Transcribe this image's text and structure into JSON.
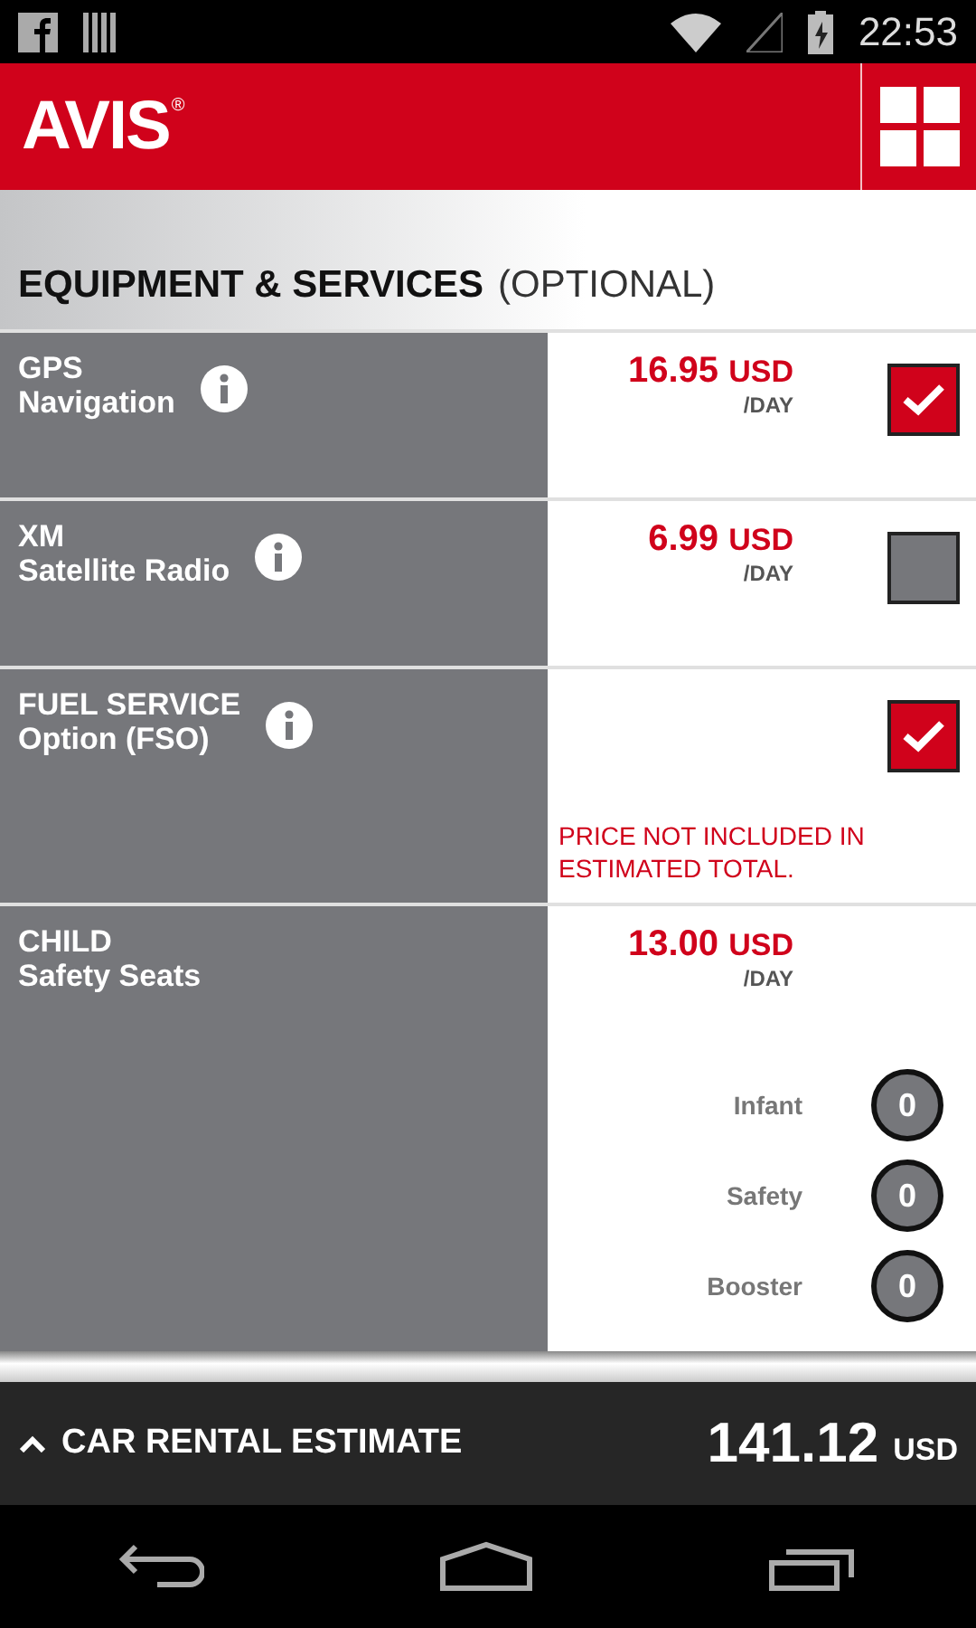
{
  "status_bar": {
    "time": "22:53"
  },
  "header": {
    "logo": "AVIS",
    "logo_mark": "®"
  },
  "section": {
    "title": "EQUIPMENT & SERVICES",
    "subtitle": "(OPTIONAL)"
  },
  "items": [
    {
      "kind": "checkbox",
      "name_line1": "GPS",
      "name_line2": "Navigation",
      "info": true,
      "price": "16.95",
      "currency": "USD",
      "per": "/DAY",
      "checked": true
    },
    {
      "kind": "checkbox",
      "name_line1": "XM",
      "name_line2": "Satellite Radio",
      "info": true,
      "price": "6.99",
      "currency": "USD",
      "per": "/DAY",
      "checked": false
    },
    {
      "kind": "checkbox",
      "name_line1": "FUEL SERVICE",
      "name_line2": "Option (FSO)",
      "info": true,
      "note": "PRICE NOT INCLUDED IN ESTIMATED TOTAL.",
      "checked": true
    },
    {
      "kind": "counter",
      "name_line1": "CHILD",
      "name_line2": "Safety Seats",
      "info": false,
      "price": "13.00",
      "currency": "USD",
      "per": "/DAY",
      "counters": [
        {
          "label": "Infant",
          "value": "0"
        },
        {
          "label": "Safety",
          "value": "0"
        },
        {
          "label": "Booster",
          "value": "0"
        }
      ]
    }
  ],
  "estimate": {
    "label": "CAR RENTAL ESTIMATE",
    "amount": "141.12",
    "currency": "USD"
  }
}
